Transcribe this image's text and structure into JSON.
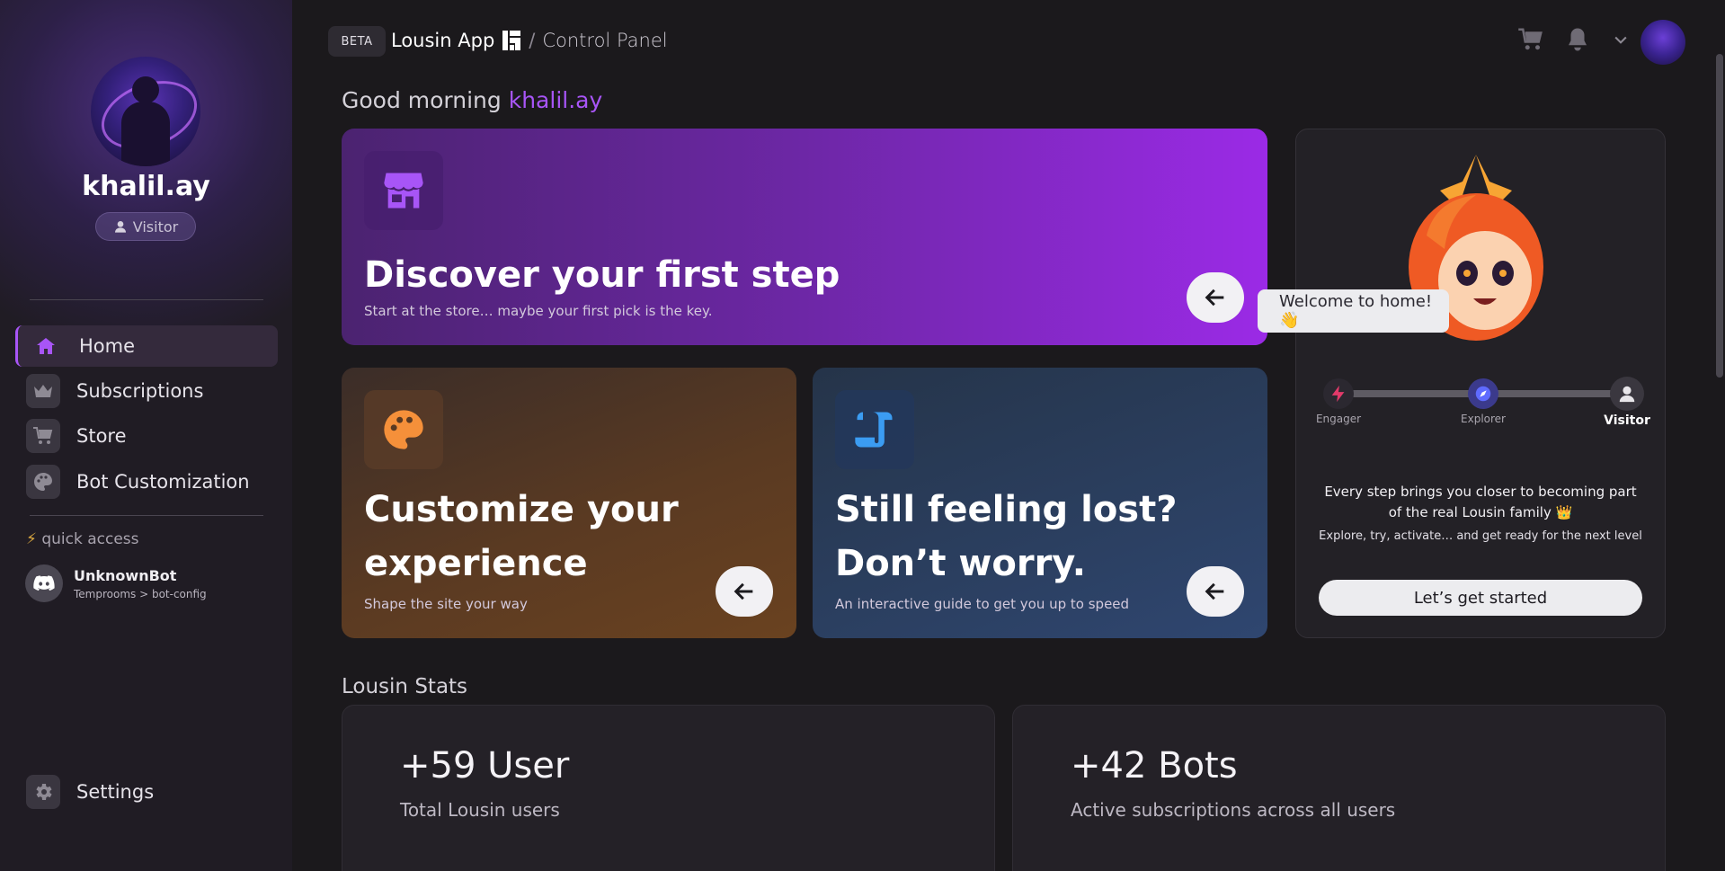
{
  "sidebar": {
    "username": "khalil.ay",
    "role": "Visitor",
    "nav": [
      {
        "label": "Home",
        "icon": "home-icon",
        "active": true
      },
      {
        "label": "Subscriptions",
        "icon": "crown-icon",
        "active": false
      },
      {
        "label": "Store",
        "icon": "cart-icon",
        "active": false
      },
      {
        "label": "Bot Customization",
        "icon": "palette-icon",
        "active": false
      }
    ],
    "quick_access_label": "quick access",
    "quick_access_item": {
      "name": "UnknownBot",
      "path": "Temprooms > bot-config"
    },
    "settings_label": "Settings"
  },
  "header": {
    "badge": "BETA",
    "app_name": "Lousin App",
    "separator": "/",
    "page": "Control Panel"
  },
  "greeting": {
    "text": "Good morning",
    "username": "khalil.ay"
  },
  "cards": {
    "discover": {
      "title": "Discover your first step",
      "subtitle": "Start at the store… maybe your first pick is the key."
    },
    "customize": {
      "title": "Customize your experience",
      "subtitle": "Shape the site your way"
    },
    "lost": {
      "title": "Still feeling lost? Don’t worry.",
      "subtitle": "An interactive guide to get you up to speed"
    }
  },
  "panel": {
    "welcome": "Welcome to home! 👋",
    "steps": [
      {
        "label": "Engager"
      },
      {
        "label": "Explorer"
      },
      {
        "label": "Visitor"
      }
    ],
    "line1": "Every step brings you closer to becoming part of the real Lousin family 👑",
    "line2": "Explore, try, activate… and get ready for the next level",
    "button": "Let’s get started"
  },
  "stats": {
    "title": "Lousin Stats",
    "users": {
      "value": "+59 User",
      "label": "Total Lousin users"
    },
    "bots": {
      "value": "+42 Bots",
      "label": "Active subscriptions across all users"
    }
  },
  "colors": {
    "accent": "#a855f7",
    "background": "#1b191c",
    "sidebar": "#201c24"
  }
}
